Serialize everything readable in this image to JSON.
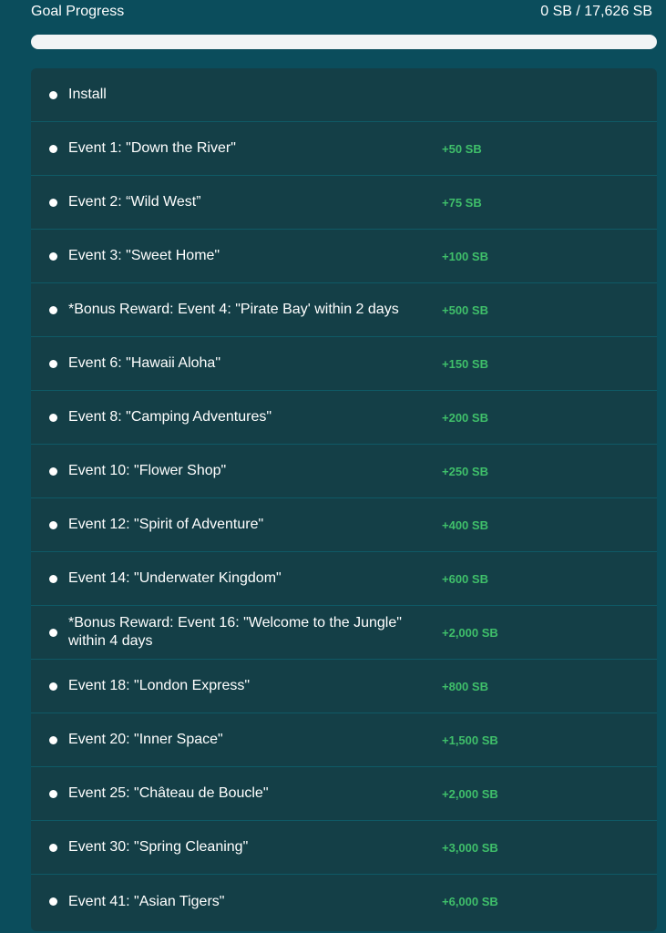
{
  "goal": {
    "title": "Goal Progress",
    "status": "0 SB / 17,626 SB",
    "progress_percent": 0
  },
  "milestones": [
    {
      "label": "Install",
      "reward": ""
    },
    {
      "label": "Event 1: \"Down the River\"",
      "reward": "+50 SB"
    },
    {
      "label": "Event 2: “Wild West”",
      "reward": "+75 SB"
    },
    {
      "label": "Event 3: \"Sweet Home\"",
      "reward": "+100 SB"
    },
    {
      "label": "*Bonus Reward: Event 4: \"Pirate Bay' within 2 days",
      "reward": "+500 SB"
    },
    {
      "label": "Event 6: \"Hawaii Aloha\"",
      "reward": "+150 SB"
    },
    {
      "label": "Event 8: \"Camping Adventures\"",
      "reward": "+200 SB"
    },
    {
      "label": "Event 10: \"Flower Shop\"",
      "reward": "+250 SB"
    },
    {
      "label": "Event 12: \"Spirit of Adventure\"",
      "reward": "+400 SB"
    },
    {
      "label": "Event 14: \"Underwater Kingdom\"",
      "reward": "+600 SB"
    },
    {
      "label": "*Bonus Reward: Event 16: \"Welcome to the Jungle\" within 4 days",
      "reward": "+2,000 SB"
    },
    {
      "label": "Event 18: \"London Express\"",
      "reward": "+800 SB"
    },
    {
      "label": "Event 20: \"Inner Space\"",
      "reward": "+1,500 SB"
    },
    {
      "label": "Event 25: \"Château de Boucle\"",
      "reward": "+2,000 SB"
    },
    {
      "label": "Event 30: \"Spring Cleaning\"",
      "reward": "+3,000 SB"
    },
    {
      "label": "Event 41: \"Asian Tigers\"",
      "reward": "+6,000 SB"
    }
  ],
  "colors": {
    "background": "#0b4d5c",
    "panel": "#143f47",
    "reward_green": "#3fbf6a",
    "track": "#f2f4f5"
  }
}
